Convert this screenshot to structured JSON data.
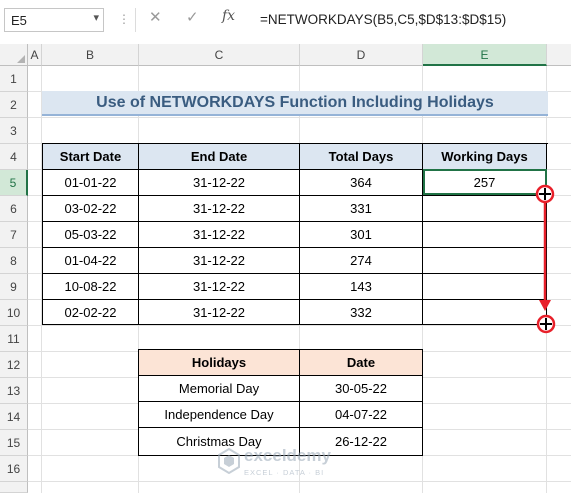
{
  "formula_bar": {
    "name_box": "E5",
    "formula": "=NETWORKDAYS(B5,C5,$D$13:$D$15)",
    "cancel_icon": "✕",
    "enter_icon": "✓",
    "fx_icon": "fx"
  },
  "columns": [
    "A",
    "B",
    "C",
    "D",
    "E"
  ],
  "rows": [
    "1",
    "2",
    "3",
    "4",
    "5",
    "6",
    "7",
    "8",
    "9",
    "10",
    "11",
    "12",
    "13",
    "14",
    "15",
    "16"
  ],
  "title": "Use of NETWORKDAYS Function Including Holidays",
  "main_table": {
    "headers": [
      "Start Date",
      "End Date",
      "Total Days",
      "Working Days"
    ],
    "rows": [
      [
        "01-01-22",
        "31-12-22",
        "364",
        "257"
      ],
      [
        "03-02-22",
        "31-12-22",
        "331",
        ""
      ],
      [
        "05-03-22",
        "31-12-22",
        "301",
        ""
      ],
      [
        "01-04-22",
        "31-12-22",
        "274",
        ""
      ],
      [
        "10-08-22",
        "31-12-22",
        "143",
        ""
      ],
      [
        "02-02-22",
        "31-12-22",
        "332",
        ""
      ]
    ]
  },
  "holidays_table": {
    "headers": [
      "Holidays",
      "Date"
    ],
    "rows": [
      [
        "Memorial Day",
        "30-05-22"
      ],
      [
        "Independence Day",
        "04-07-22"
      ],
      [
        "Christmas Day",
        "26-12-22"
      ]
    ]
  },
  "selected_cell": "E5",
  "watermark": {
    "name": "exceldemy",
    "tagline": "EXCEL · DATA · BI"
  },
  "colors": {
    "accent_green": "#217346",
    "header_blue": "#dce6f1",
    "header_peach": "#fce4d6",
    "annotation_red": "#e8202a"
  }
}
